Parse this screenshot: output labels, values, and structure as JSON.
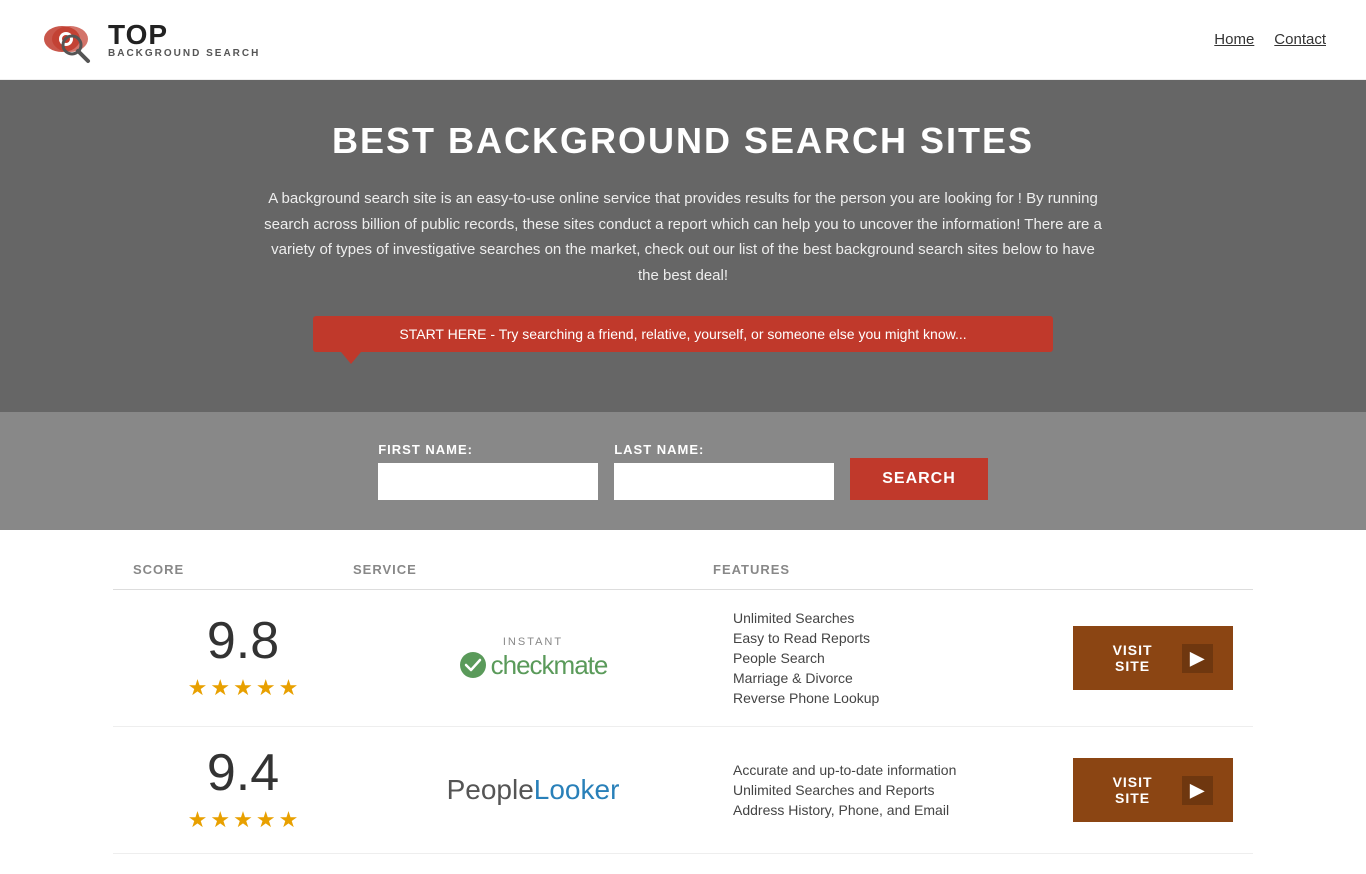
{
  "header": {
    "logo_top": "TOP",
    "logo_bottom": "BACKGROUND SEARCH",
    "nav": [
      {
        "label": "Home",
        "href": "#"
      },
      {
        "label": "Contact",
        "href": "#"
      }
    ]
  },
  "hero": {
    "title": "BEST BACKGROUND SEARCH SITES",
    "description": "A background search site is an easy-to-use online service that provides results  for the person you are looking for ! By  running  search across billion of public records, these sites conduct  a report which can help you to uncover the information! There are a variety of types of investigative searches on the market, check out our  list of the best background search sites below to have the best deal!",
    "callout": "START HERE - Try searching a friend, relative, yourself, or someone else you might know..."
  },
  "search_form": {
    "first_name_label": "FIRST NAME:",
    "last_name_label": "LAST NAME:",
    "button_label": "SEARCH",
    "first_name_placeholder": "",
    "last_name_placeholder": ""
  },
  "table": {
    "headers": [
      {
        "label": "SCORE",
        "key": "score"
      },
      {
        "label": "SERVICE",
        "key": "service"
      },
      {
        "label": "FEATURES",
        "key": "features"
      },
      {
        "label": "",
        "key": "action"
      }
    ],
    "rows": [
      {
        "score": "9.8",
        "stars": 4.5,
        "service_name": "Instant Checkmate",
        "service_type": "checkmate",
        "features": [
          "Unlimited Searches",
          "Easy to Read Reports",
          "People Search",
          "Marriage & Divorce",
          "Reverse Phone Lookup"
        ],
        "visit_label": "VISIT SITE"
      },
      {
        "score": "9.4",
        "stars": 4.5,
        "service_name": "PeopleLooker",
        "service_type": "peoplelooker",
        "features": [
          "Accurate and up-to-date information",
          "Unlimited Searches and Reports",
          "Address History, Phone, and Email"
        ],
        "visit_label": "VISIT SITE"
      }
    ]
  },
  "colors": {
    "red": "#c0392b",
    "visit_btn": "#8b4513",
    "star": "#e8a000",
    "hero_bg": "#666666",
    "checkmate_green": "#5a9a5a"
  }
}
